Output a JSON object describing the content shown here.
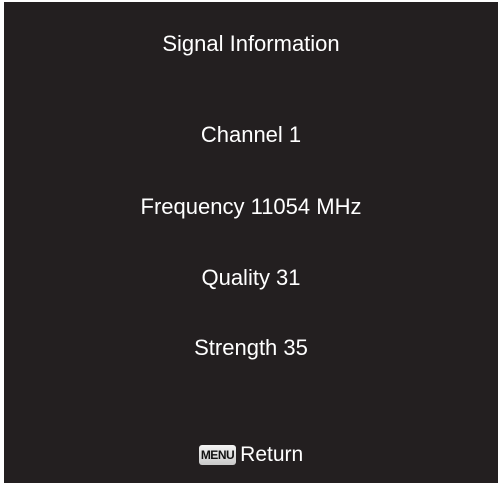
{
  "screen": {
    "title": "Signal Information",
    "channel": "Channel 1",
    "frequency": "Frequency 11054 MHz",
    "quality": "Quality 31",
    "strength": "Strength 35"
  },
  "footer": {
    "menu_key": "MENU",
    "return_label": "Return"
  },
  "colors": {
    "background": "#231f20",
    "text": "#ffffff"
  }
}
